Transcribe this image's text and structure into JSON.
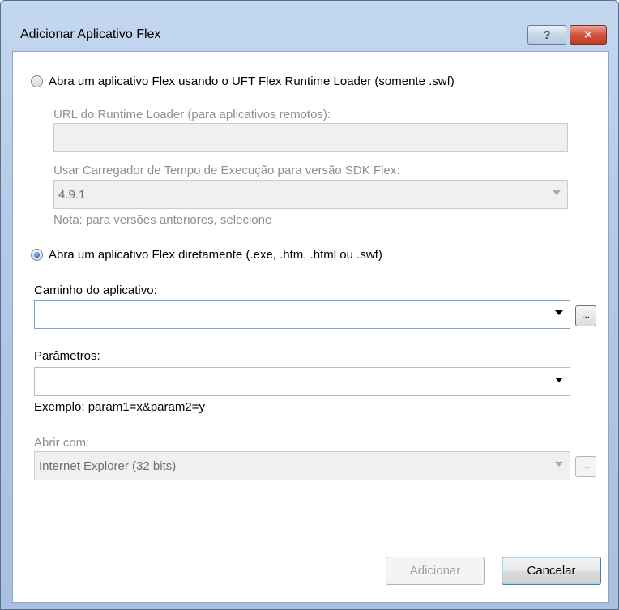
{
  "window": {
    "title": "Adicionar Aplicativo Flex",
    "help_glyph": "?",
    "close_glyph": "✕"
  },
  "option_runtime": {
    "label": "Abra um aplicativo Flex usando o UFT Flex Runtime Loader (somente .swf)",
    "checked": false,
    "url_label": "URL do Runtime Loader (para aplicativos remotos):",
    "url_value": "",
    "sdk_label": "Usar Carregador de Tempo de Execução para versão SDK Flex:",
    "sdk_value": "4.9.1",
    "note": "Nota: para versões anteriores, selecione"
  },
  "option_direct": {
    "label": "Abra um aplicativo Flex diretamente (.exe, .htm, .html ou .swf)",
    "checked": true
  },
  "app_path": {
    "label": "Caminho do aplicativo:",
    "value": "",
    "browse_label": "..."
  },
  "params": {
    "label": "Parâmetros:",
    "value": "",
    "example": "Exemplo: param1=x&param2=y"
  },
  "open_with": {
    "label": "Abrir com:",
    "value": "Internet Explorer (32 bits)",
    "browse_label": "..."
  },
  "buttons": {
    "add": "Adicionar",
    "cancel": "Cancelar"
  }
}
